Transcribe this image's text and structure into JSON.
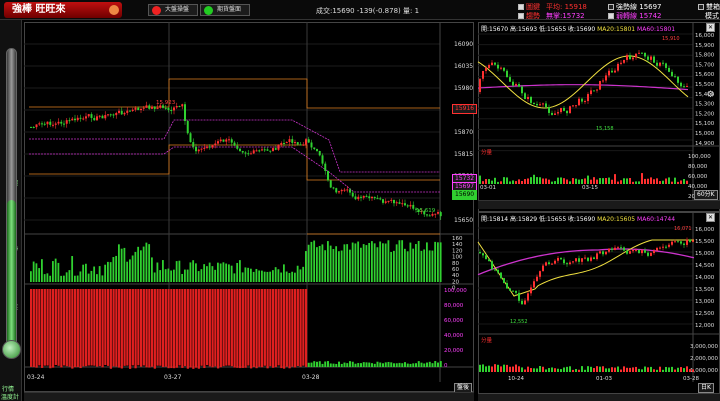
{
  "topbar": {
    "logo": "強棒 旺旺來",
    "btn_market": "大盤操盤",
    "btn_futures": "期貨盤面",
    "quote": "成交:15690  -139(-0.878)  量: 1",
    "chk_a": "圖鍵",
    "chk_b": "趨勢",
    "avg_cost_label": "平均: 15918",
    "avg_cost2_label": "無掌:15732",
    "strong_label": "強勢線",
    "strong_val": "15697",
    "weak_label": "弱轉線",
    "weak_val": "15742",
    "mode_a": "雙箱",
    "mode_b": "模式",
    "colors": {
      "red": "#ff3030",
      "green": "#30d030",
      "magenta": "#ff40ff"
    }
  },
  "sidebar": {
    "top_label": "趨",
    "mid_label": "勢",
    "low_label": "盤",
    "bottom_label1": "行情",
    "bottom_label2": "溫度計"
  },
  "main": {
    "price_ticks": [
      "16090",
      "16035",
      "15980",
      "15925",
      "15870",
      "15815",
      "15760",
      "15705",
      "15650"
    ],
    "vol_ticks": [
      "160",
      "140",
      "120",
      "100",
      "80",
      "60",
      "40",
      "20",
      "0"
    ],
    "amt_ticks": [
      "100,000",
      "80,000",
      "60,000",
      "40,000",
      "20,000",
      "0"
    ],
    "date_ticks": [
      "03-24",
      "03-27",
      "03-28"
    ],
    "hi_label": "15,923",
    "lo_label": "15,619",
    "tag_red": "15916",
    "tag_m1": "15732",
    "tag_m2": "15697",
    "tag_cur": "15690",
    "bottom_btn": "盤後",
    "bottom_btn2": "資訊"
  },
  "ur": {
    "legend": "開:15670  高:15693  低:15655  收:15690",
    "ma20": "MA20:15801",
    "ma60": "MA60:15801",
    "ticks": [
      "16,000",
      "15,900",
      "15,800",
      "15,700",
      "15,600",
      "15,500",
      "15,400",
      "15,300",
      "15,200",
      "15,100",
      "15,000",
      "14,900"
    ],
    "vol_ticks": [
      "100,000",
      "80,000",
      "60,000",
      "40,000",
      "20,000"
    ],
    "dates": [
      "03-01",
      "03-15"
    ],
    "hi_label": "15,910",
    "lo_label": "15,158",
    "vol_label": "分量",
    "period_btn": "60分K"
  },
  "lr": {
    "legend": "開:15814  高:15829  低:15655  收:15690",
    "ma20": "MA20:15605",
    "ma60": "MA60:14744",
    "ticks": [
      "16,000",
      "15,500",
      "15,000",
      "14,500",
      "14,000",
      "13,500",
      "13,000",
      "12,500",
      "12,000"
    ],
    "vol_ticks": [
      "3,000,000",
      "2,000,000",
      "1,000,000"
    ],
    "dates": [
      "10-24",
      "01-03",
      "03-28"
    ],
    "hi_label": "16,071",
    "lo_label": "12,552",
    "vol_label": "分量",
    "period_btn": "日K"
  }
}
